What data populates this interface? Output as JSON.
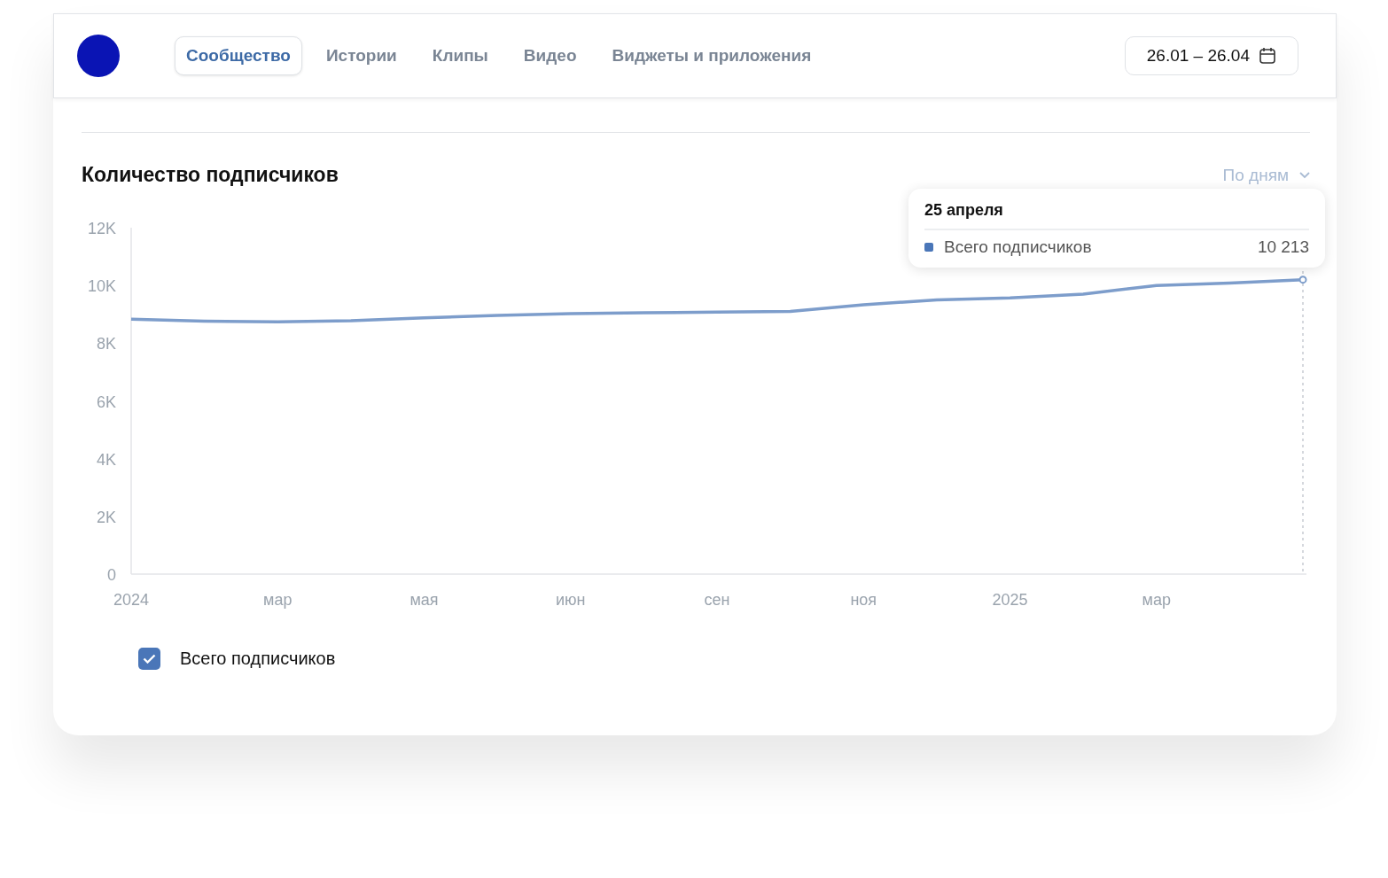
{
  "tabs": [
    {
      "label": "Сообщество",
      "selected": true
    },
    {
      "label": "Истории",
      "selected": false
    },
    {
      "label": "Клипы",
      "selected": false
    },
    {
      "label": "Видео",
      "selected": false
    },
    {
      "label": "Виджеты и приложения",
      "selected": false
    }
  ],
  "date_range": "26.01 – 26.04",
  "subscribers": {
    "title": "Количество подписчиков",
    "period": "По дням",
    "tooltip": {
      "date": "25 апреля",
      "series": "Всего подписчиков",
      "value": "10 213",
      "color": "#4a76b8"
    },
    "chart_data": {
      "type": "line",
      "categories": [
        "2024",
        null,
        "мар",
        null,
        "мая",
        null,
        "июн",
        null,
        "сен",
        null,
        "ноя",
        null,
        "2025",
        null,
        "мар",
        null,
        null
      ],
      "series": [
        {
          "name": "Всего подписчиков",
          "color": "#7d9dcb",
          "values": [
            8830,
            8760,
            8740,
            8780,
            8880,
            8960,
            9020,
            9050,
            9080,
            9100,
            9330,
            9500,
            9570,
            9700,
            10000,
            10080,
            10200
          ]
        }
      ],
      "ylim": [
        0,
        12000
      ],
      "yticks": [
        {
          "value": 0,
          "label": "0"
        },
        {
          "value": 2000,
          "label": "2K"
        },
        {
          "value": 4000,
          "label": "4K"
        },
        {
          "value": 6000,
          "label": "6K"
        },
        {
          "value": 8000,
          "label": "8K"
        },
        {
          "value": 10000,
          "label": "10K"
        },
        {
          "value": 12000,
          "label": "12K"
        }
      ]
    },
    "legend": [
      {
        "checked": true
      }
    ]
  }
}
